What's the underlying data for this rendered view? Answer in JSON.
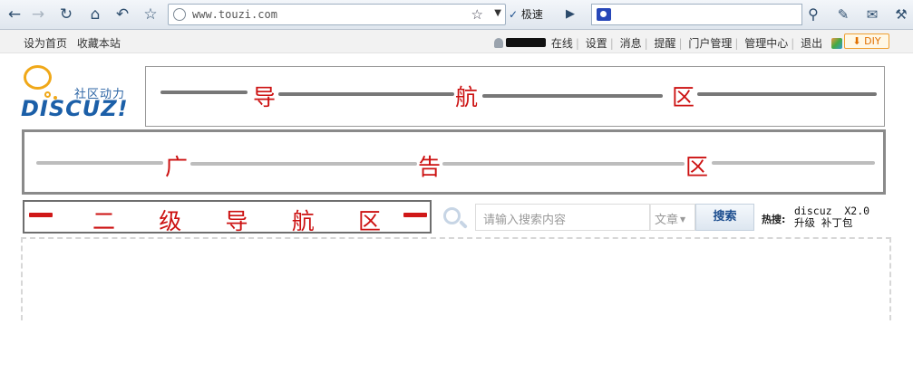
{
  "browser": {
    "url": "www.touzi.com",
    "speed_label": "极速",
    "search_placeholder": ""
  },
  "topbar": {
    "left_links": [
      "设为首页",
      "收藏本站"
    ],
    "status": "在线",
    "links": [
      "设置",
      "消息",
      "提醒",
      "门户管理",
      "管理中心",
      "退出"
    ],
    "diy_label": "DIY",
    "diy_arrow": "⬇"
  },
  "logo": {
    "slogan": "社区动力",
    "wordmark": "DISCUZ!"
  },
  "nav_zone": {
    "chars": [
      "导",
      "航",
      "区"
    ]
  },
  "ad_zone": {
    "chars": [
      "广",
      "告",
      "区"
    ]
  },
  "subnav_zone": {
    "chars": [
      "二",
      "级",
      "导",
      "航",
      "区"
    ]
  },
  "search": {
    "placeholder": "请输入搜索内容",
    "type": "文章",
    "button": "搜索",
    "hot_label": "热搜:",
    "hot_keywords": [
      "discuz  X2.0",
      "升级 补丁包"
    ]
  },
  "colors": {
    "zone_text": "#cc1111",
    "link_blue": "#1d4e8f",
    "logo_orange": "#f0a818"
  }
}
